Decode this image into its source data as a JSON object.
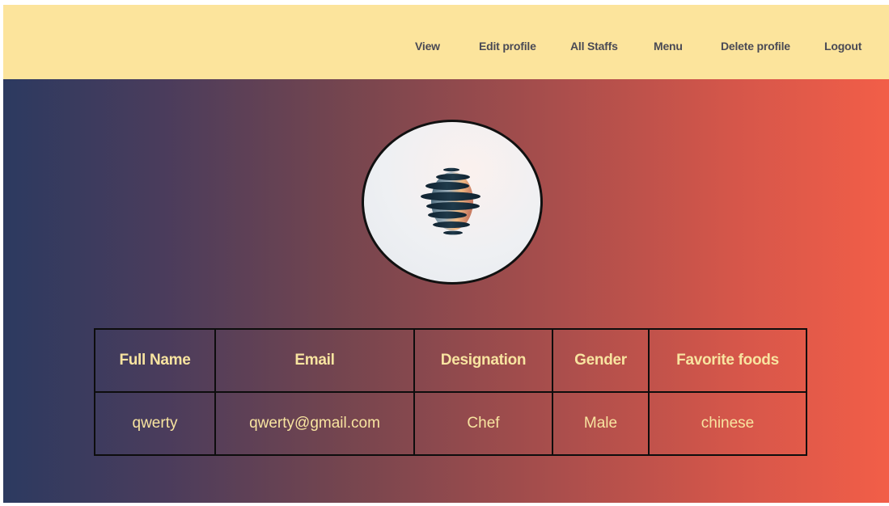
{
  "nav": {
    "items": [
      {
        "label": "View"
      },
      {
        "label": "Edit profile"
      },
      {
        "label": "All Staffs"
      },
      {
        "label": "Menu"
      },
      {
        "label": "Delete profile"
      },
      {
        "label": "Logout"
      }
    ]
  },
  "avatar": {
    "icon": "spiral-sphere-logo-icon"
  },
  "table": {
    "headers": [
      "Full Name",
      "Email",
      "Designation",
      "Gender",
      "Favorite foods"
    ],
    "rows": [
      [
        "qwerty",
        "qwerty@gmail.com",
        "Chef",
        "Male",
        "chinese"
      ]
    ]
  },
  "colors": {
    "navbar_bg": "#fce49c",
    "nav_text": "#4a4a55",
    "gradient_start": "#2c3a60",
    "gradient_end": "#f25e48",
    "table_text": "#f8e4a0",
    "border": "#0d0d0d"
  }
}
